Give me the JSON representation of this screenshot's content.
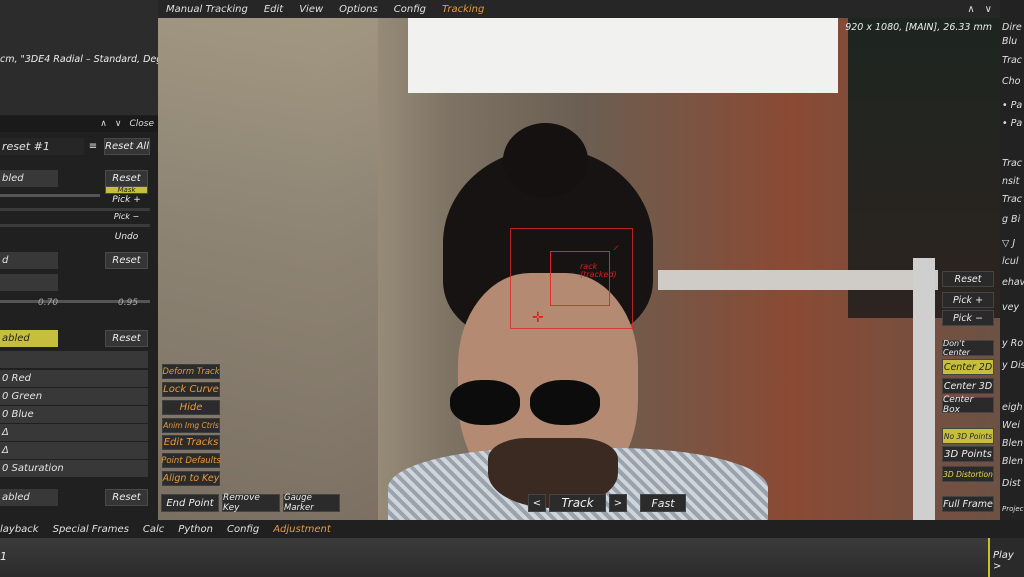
{
  "menubar": {
    "items": [
      "Manual Tracking",
      "Edit",
      "View",
      "Options",
      "Config",
      "Tracking"
    ],
    "arrow_up": "∧",
    "arrow_down": "∨"
  },
  "leftpanel": {
    "lens_text": "cm, \"3DE4 Radial – Standard, Degr",
    "nav_up": "∧",
    "nav_down": "∨",
    "close_label": "Close",
    "preset_label": "reset #1",
    "menu_icon": "≡",
    "reset_all_label": "Reset All",
    "enabled_1": "bled",
    "reset_label": "Reset",
    "mask_label": "Mask",
    "pick_plus": "Pick +",
    "pick_minus": "Pick −",
    "undo": "Undo",
    "field_d": "d",
    "slider_min": "0.70",
    "slider_max": "0.95",
    "enabled_2": "abled",
    "red": "0 Red",
    "green": "0 Green",
    "blue": "0 Blue",
    "delta1": "Δ",
    "delta2": "Δ",
    "saturation": "0 Saturation",
    "enabled_3": "abled"
  },
  "viewport": {
    "resolution": "920 x 1080, [MAIN], 26.33 mm",
    "track_label_1": "rack",
    "track_label_2": "(tracked)",
    "cross": "✛",
    "left_buttons": [
      "Deform Track",
      "Lock Curve",
      "Hide",
      "Anim Img Ctrls",
      "Edit Tracks",
      "Point Defaults",
      "Align to Key"
    ],
    "bottom": {
      "end_point": "End Point",
      "remove_key": "Remove Key",
      "gauge_marker": "Gauge Marker",
      "prev": "<",
      "track": "Track",
      "next": ">",
      "fast": "Fast"
    },
    "right_buttons": {
      "reset": "Reset",
      "pick_plus": "Pick +",
      "pick_minus": "Pick −",
      "dont_center": "Don't Center",
      "center_2d": "Center 2D",
      "center_3d": "Center 3D",
      "center_box": "Center Box",
      "no_3d_points": "No 3D Points",
      "3d_points": "3D Points",
      "3d_distortion": "3D Distortion",
      "full_frame": "Full Frame"
    }
  },
  "rightpanel": {
    "items": [
      "Dire",
      "Blu",
      "Trac",
      "Cho",
      "• Pa",
      "• Pa",
      "Trac",
      "nsit",
      "Trac",
      "g Bi",
      "▽ J",
      "lcul",
      "ehav",
      "vey",
      "y Ro",
      "y Dis",
      "eigh",
      "Wei",
      "Blen",
      "Blen",
      "Dist",
      "Project"
    ]
  },
  "bottombar": {
    "items": [
      "layback",
      "Special Frames",
      "Calc",
      "Python",
      "Config",
      "Adjustment"
    ]
  },
  "timeline": {
    "frame": "1",
    "play": "Play >"
  }
}
